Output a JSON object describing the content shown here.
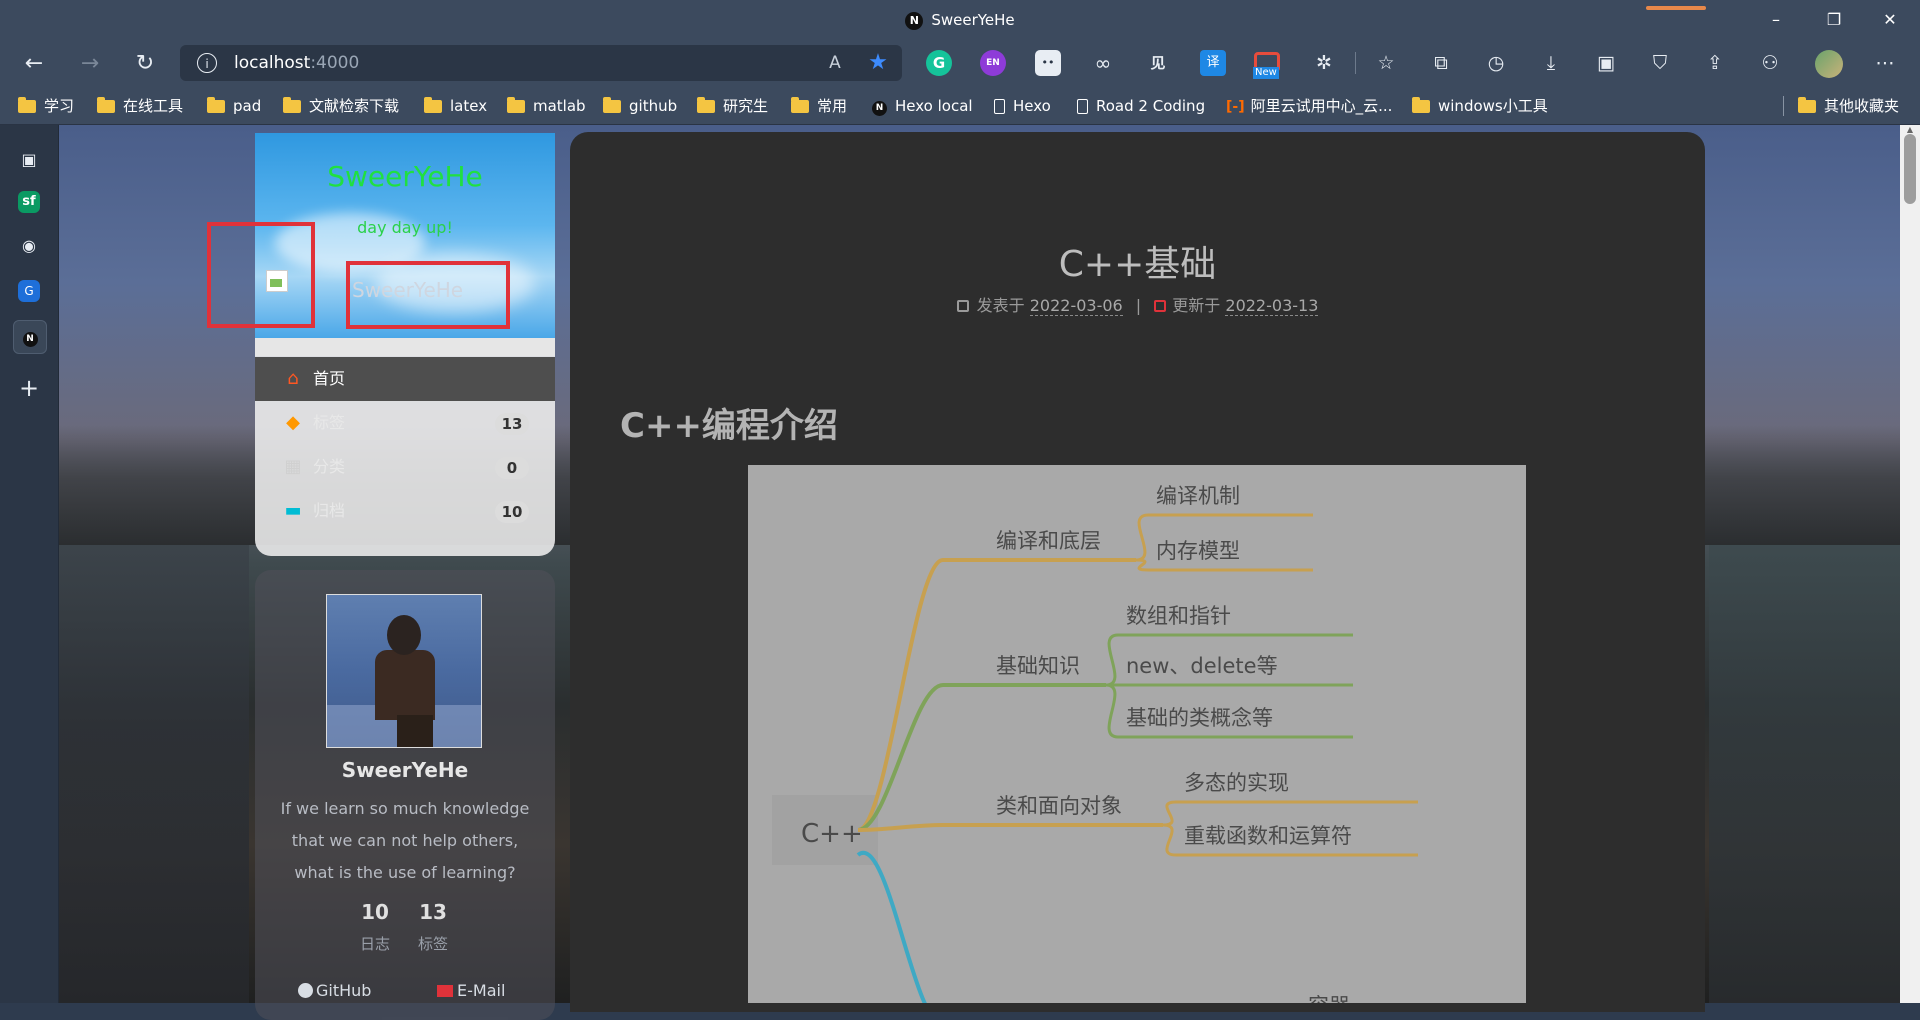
{
  "browser": {
    "window_title": "SweerYeHe",
    "address": {
      "host": "localhost",
      "port": ":4000"
    },
    "tab_favicon": "N",
    "extensions": [
      "grammarly-icon",
      "en-extension-icon",
      "bilibili-icon",
      "infinity-icon",
      "jian-icon",
      "translate-icon",
      "new-extension-icon",
      "puzzle-icon"
    ],
    "extension_badges": {
      "en": "EN",
      "translate": "译",
      "new": "New",
      "grammarly": "G",
      "jian": "见"
    },
    "colors": {
      "chrome": "#3c4a5e",
      "accent_star": "#3d8bfd",
      "folder": "#f4c542",
      "highlight_red": "#e0323a"
    }
  },
  "bookmarks": [
    {
      "label": "学习",
      "type": "folder"
    },
    {
      "label": "在线工具",
      "type": "folder"
    },
    {
      "label": "pad",
      "type": "folder"
    },
    {
      "label": "文献检索下载",
      "type": "folder"
    },
    {
      "label": "latex",
      "type": "folder"
    },
    {
      "label": "matlab",
      "type": "folder"
    },
    {
      "label": "github",
      "type": "folder"
    },
    {
      "label": "研究生",
      "type": "folder"
    },
    {
      "label": "常用",
      "type": "folder"
    },
    {
      "label": "Hexo local",
      "type": "notion"
    },
    {
      "label": "Hexo",
      "type": "page"
    },
    {
      "label": "Road 2 Coding",
      "type": "page"
    },
    {
      "label": "阿里云试用中心_云...",
      "type": "aliyun"
    },
    {
      "label": "windows小工具",
      "type": "folder"
    },
    {
      "label": "其他收藏夹",
      "type": "folder"
    }
  ],
  "site": {
    "title": "SweerYeHe",
    "subtitle": "day day up!",
    "header_name": "SweerYeHe",
    "menu": [
      {
        "label": "首页",
        "icon": "home-icon",
        "count": ""
      },
      {
        "label": "标签",
        "icon": "tags-icon",
        "count": "13"
      },
      {
        "label": "分类",
        "icon": "grid-icon",
        "count": "0"
      },
      {
        "label": "归档",
        "icon": "archive-icon",
        "count": "10"
      }
    ],
    "author": {
      "name": "SweerYeHe",
      "motto": "If we learn so much knowledge that we can not help others, what is the use of learning?",
      "stats": [
        {
          "num": "10",
          "label": "日志"
        },
        {
          "num": "13",
          "label": "标签"
        }
      ],
      "links": [
        {
          "label": "GitHub",
          "icon": "github-icon"
        },
        {
          "label": "E-Mail",
          "icon": "mail-icon"
        }
      ]
    }
  },
  "post": {
    "title": "C++基础",
    "posted_label": "发表于",
    "posted_date": "2022-03-06",
    "separator": "|",
    "updated_label": "更新于",
    "updated_date": "2022-03-13",
    "section_heading": "C++编程介绍"
  },
  "mindmap": {
    "root": "C++",
    "branches": [
      {
        "label": "编译和底层",
        "color": "#c7a050",
        "children": [
          "编译机制",
          "内存模型"
        ]
      },
      {
        "label": "基础知识",
        "color": "#7fa35a",
        "children": [
          "数组和指针",
          "new、delete等",
          "基础的类概念等"
        ]
      },
      {
        "label": "类和面向对象",
        "color": "#c7a050",
        "children": [
          "多态的实现",
          "重载函数和运算符"
        ]
      },
      {
        "label": "容器",
        "color": "#3fa9c4",
        "children": []
      }
    ]
  }
}
